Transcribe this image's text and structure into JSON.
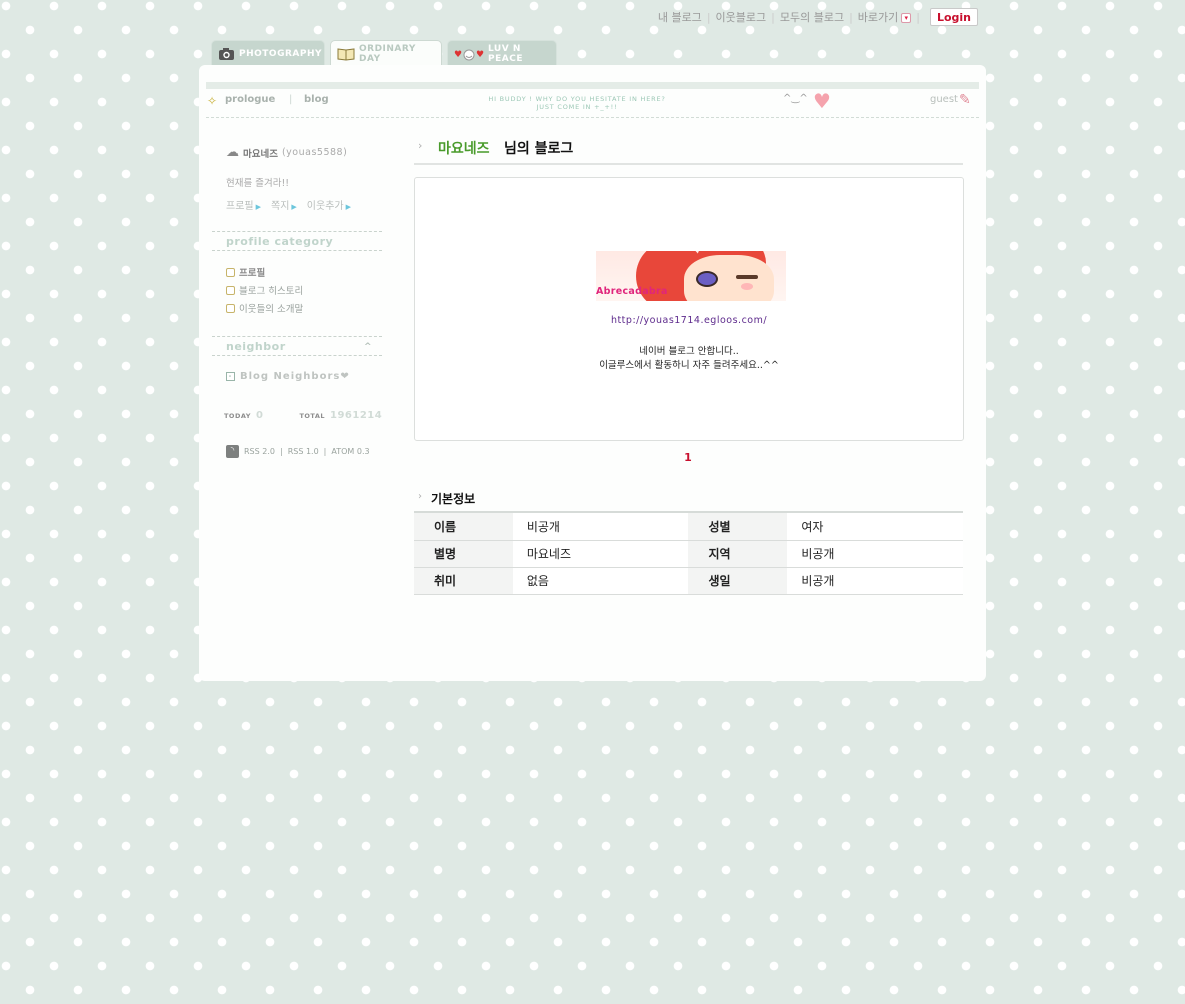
{
  "topbar": {
    "links": [
      "내 블로그",
      "이웃블로그",
      "모두의 블로그"
    ],
    "shortcut": "바로가기",
    "login": "Login"
  },
  "tabs": [
    {
      "label": "PHOTOGRAPHY",
      "icon": "camera-icon"
    },
    {
      "label": "ORDINARY DAY",
      "icon": "book-icon"
    },
    {
      "label": "LUV N PEACE",
      "icon": "smiley-hearts-icon"
    }
  ],
  "nav": {
    "prologue": "prologue",
    "blog": "blog",
    "slogan_line1": "HI BUDDY ! WHY DO YOU HESITATE IN HERE?",
    "slogan_line2": "JUST COME IN +_+!!",
    "face": "^‿^",
    "guest": "guest"
  },
  "profile": {
    "name": "마요네즈",
    "id": "(youas5588)",
    "status": "현재를 즐겨라!!",
    "links": [
      "프로필",
      "쪽지",
      "이웃추가"
    ]
  },
  "sidebar": {
    "profile_category_title": "profile category",
    "categories": [
      "프로필",
      "블로그 히스토리",
      "이웃들의 소개말"
    ],
    "neighbor_title": "neighbor",
    "neighbor_item": "Blog Neighbors❤",
    "today_label": "TODAY",
    "today_value": "0",
    "total_label": "TOTAL",
    "total_value": "1961214",
    "rss": [
      "RSS 2.0",
      "RSS 1.0",
      "ATOM 0.3"
    ]
  },
  "main": {
    "title_name": "마요네즈",
    "title_suffix": "님의 블로그",
    "banner_caption": "Abrecadabra",
    "post_url": "http://youas1714.egloos.com/",
    "post_line1": "네이버 블로그 안합니다..",
    "post_line2": "이글루스에서 활동하니 자주 들려주세요..^^",
    "page": "1",
    "info_title": "기본정보",
    "info_rows": [
      [
        {
          "k": "이름",
          "v": "비공개"
        },
        {
          "k": "성별",
          "v": "여자"
        }
      ],
      [
        {
          "k": "별명",
          "v": "마요네즈"
        },
        {
          "k": "지역",
          "v": "비공개"
        }
      ],
      [
        {
          "k": "취미",
          "v": "없음"
        },
        {
          "k": "생일",
          "v": "비공개"
        }
      ]
    ]
  },
  "colors": {
    "background": "#dfe9e4",
    "accent_red": "#c8102e",
    "title_green": "#4a9b2b"
  }
}
